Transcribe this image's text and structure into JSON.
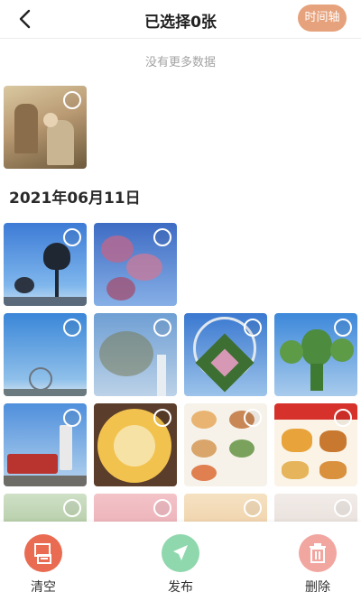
{
  "header": {
    "title": "已选择0张",
    "timeline_label": "时间轴"
  },
  "status": {
    "no_more_data": "没有更多数据"
  },
  "sections": [
    {
      "date": "2021年06月11日"
    }
  ],
  "footer": {
    "clear_label": "清空",
    "publish_label": "发布",
    "delete_label": "删除"
  },
  "colors": {
    "accent": "#e6a27c",
    "clear": "#e96c52",
    "publish": "#8fd7ad",
    "delete": "#f1a6a0"
  }
}
